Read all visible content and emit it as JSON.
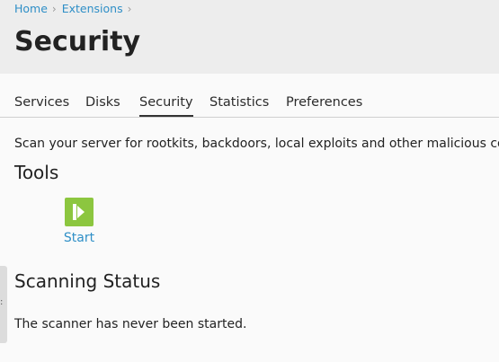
{
  "breadcrumb": {
    "items": [
      "Home",
      "Extensions"
    ],
    "separator": "›"
  },
  "page": {
    "title": "Security"
  },
  "tabs": [
    {
      "label": "Services",
      "active": false
    },
    {
      "label": "Disks",
      "active": false
    },
    {
      "label": "Security",
      "active": true
    },
    {
      "label": "Statistics",
      "active": false
    },
    {
      "label": "Preferences",
      "active": false
    }
  ],
  "main": {
    "description": "Scan your server for rootkits, backdoors, local exploits and other malicious code",
    "tools_heading": "Tools",
    "tools": [
      {
        "label": "Start",
        "icon": "play-icon",
        "icon_color": "#8cc63f"
      }
    ],
    "status_heading": "Scanning Status",
    "status_text": "The scanner has never been started."
  },
  "side_handle": {
    "glyph": ":"
  },
  "colors": {
    "link": "#2f8fc7",
    "header_bg": "#ededed",
    "page_bg": "#fafafa",
    "start_button": "#8cc63f"
  }
}
